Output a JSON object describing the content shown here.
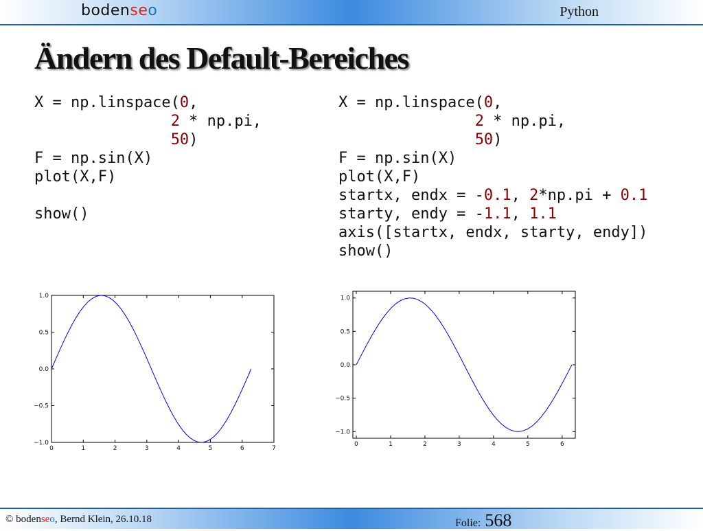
{
  "header": {
    "logo": "bodenseo",
    "topic": "Python"
  },
  "title": "Ändern des Default-Bereiches",
  "code_left": [
    [
      [
        "X = np.linspace(",
        ""
      ],
      [
        "0",
        "n"
      ],
      [
        ",",
        ""
      ]
    ],
    [
      [
        "               ",
        ""
      ],
      [
        "2",
        "n"
      ],
      [
        " * np.pi,",
        ""
      ]
    ],
    [
      [
        "               ",
        ""
      ],
      [
        "50",
        "n"
      ],
      [
        ")",
        ""
      ]
    ],
    [
      [
        "F = np.sin(X)",
        ""
      ]
    ],
    [
      [
        "plot(X,F)",
        ""
      ]
    ],
    [
      [
        "",
        ""
      ]
    ],
    [
      [
        "show()",
        ""
      ]
    ]
  ],
  "code_right": [
    [
      [
        "X = np.linspace(",
        ""
      ],
      [
        "0",
        "n"
      ],
      [
        ",",
        ""
      ]
    ],
    [
      [
        "               ",
        ""
      ],
      [
        "2",
        "n"
      ],
      [
        " * np.pi,",
        ""
      ]
    ],
    [
      [
        "               ",
        ""
      ],
      [
        "50",
        "n"
      ],
      [
        ")",
        ""
      ]
    ],
    [
      [
        "F = np.sin(X)",
        ""
      ]
    ],
    [
      [
        "plot(X,F)",
        ""
      ]
    ],
    [
      [
        "startx, endx = -",
        ""
      ],
      [
        "0.1",
        "n"
      ],
      [
        ", ",
        ""
      ],
      [
        "2",
        "n"
      ],
      [
        "*np.pi + ",
        ""
      ],
      [
        "0.1",
        "n"
      ]
    ],
    [
      [
        "starty, endy = -",
        ""
      ],
      [
        "1.1",
        "n"
      ],
      [
        ", ",
        ""
      ],
      [
        "1.1",
        "n"
      ]
    ],
    [
      [
        "axis([startx, endx, starty, endy])",
        ""
      ]
    ],
    [
      [
        "show()",
        ""
      ]
    ]
  ],
  "chart_data": [
    {
      "type": "line",
      "function": "sin(x)",
      "x_range": [
        0,
        6.283185307
      ],
      "n_points": 50,
      "xlim": [
        0,
        7
      ],
      "ylim": [
        -1.0,
        1.0
      ],
      "xticks": [
        "0",
        "1",
        "2",
        "3",
        "4",
        "5",
        "6",
        "7"
      ],
      "yticks": [
        "1.0",
        "0.5",
        "0.0",
        "−0.5",
        "−1.0"
      ],
      "line_color": "#0000ff"
    },
    {
      "type": "line",
      "function": "sin(x)",
      "x_range": [
        0,
        6.283185307
      ],
      "n_points": 50,
      "xlim": [
        -0.1,
        6.383185307
      ],
      "ylim": [
        -1.1,
        1.1
      ],
      "xticks": [
        "0",
        "1",
        "2",
        "3",
        "4",
        "5",
        "6"
      ],
      "yticks": [
        "1.0",
        "0.5",
        "0.0",
        "−0.5",
        "−1.0"
      ],
      "line_color": "#0000ff"
    }
  ],
  "footer": {
    "copyright": "©",
    "logo": "bodenseo",
    "author_date": ", Bernd Klein, 26.10.18",
    "folie_label": "Folie:",
    "folie_number": "568"
  }
}
